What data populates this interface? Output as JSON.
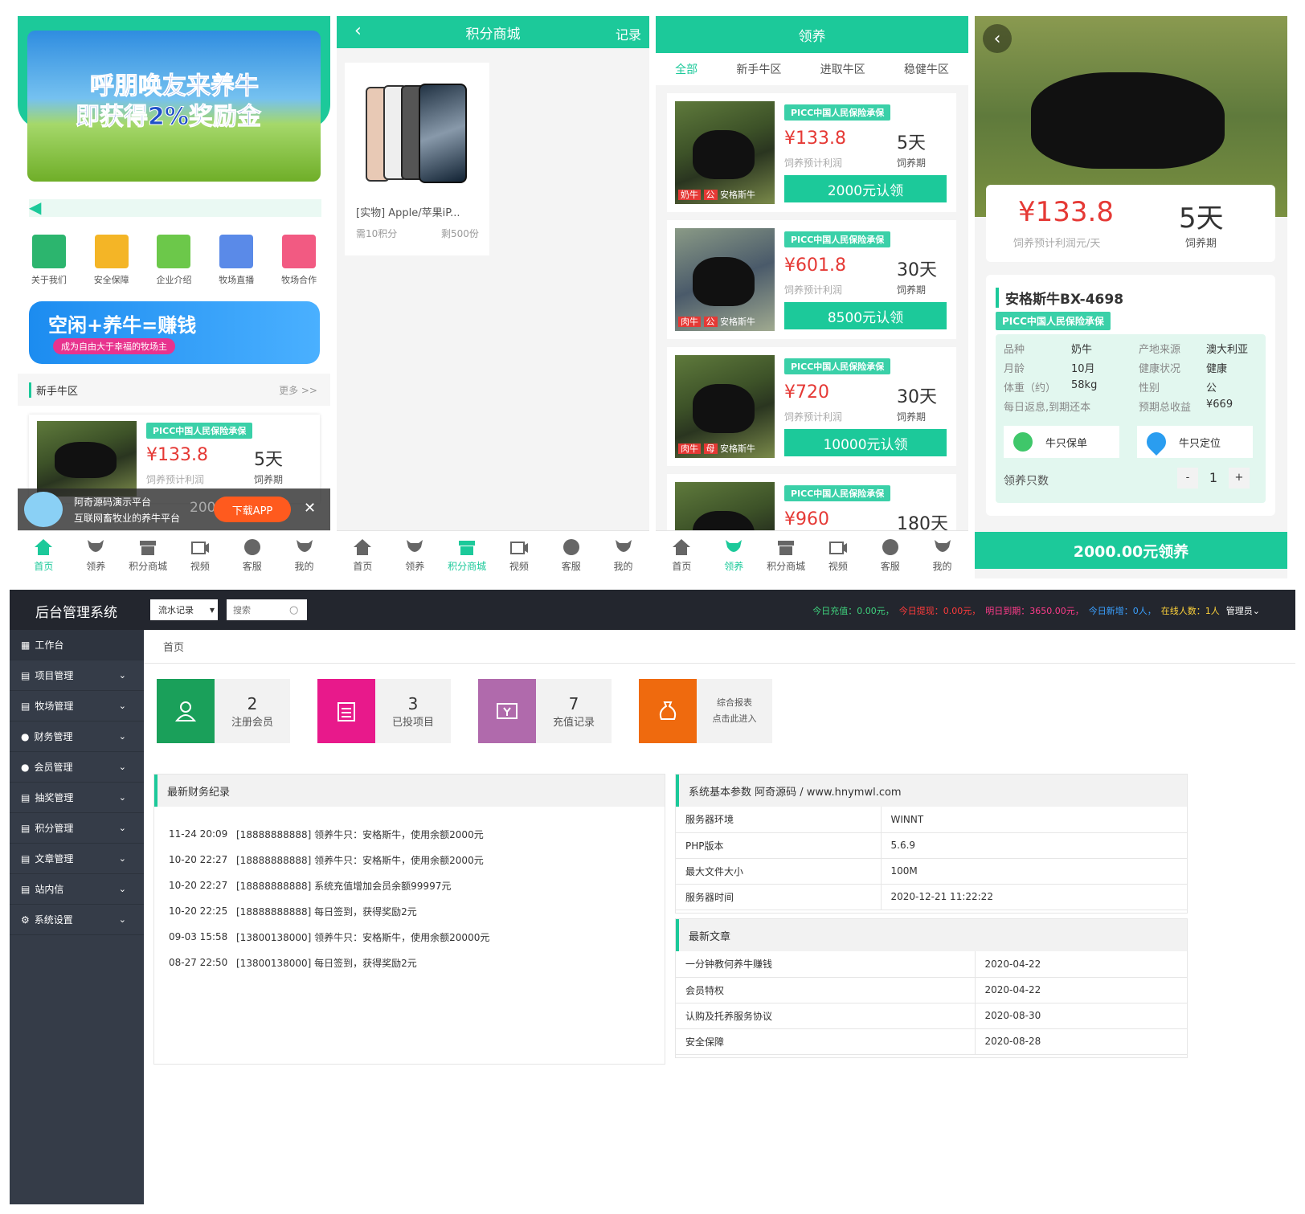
{
  "home": {
    "banner_line1": "呼朋唤友来养牛",
    "banner_line2": "即获得2%奖励金",
    "icons": [
      "关于我们",
      "安全保障",
      "企业介绍",
      "牧场直播",
      "牧场合作"
    ],
    "promo_big": "空闲+养牛=赚钱",
    "promo_small": "成为自由大于幸福的牧场主",
    "section_title": "新手牛区",
    "more": "更多 >>",
    "item": {
      "badge": "PICC中国人民保险承保",
      "price": "¥133.8",
      "days": "5天",
      "profit_label": "饲养预计利润",
      "period_label": "饲养期"
    },
    "app_banner": {
      "line1": "阿奇源码演示平台",
      "line2": "互联网畜牧业的养牛平台",
      "num": "200",
      "button": "下载APP",
      "close": "✕"
    }
  },
  "shop": {
    "title": "积分商城",
    "record": "记录",
    "product_name": "[实物] Apple/苹果iP...",
    "need": "需10积分",
    "remain": "剩500份"
  },
  "adopt": {
    "title": "领养",
    "tabs": [
      "全部",
      "新手牛区",
      "进取牛区",
      "稳健牛区"
    ],
    "items": [
      {
        "badge": "PICC中国人民保险承保",
        "price": "¥133.8",
        "days": "5天",
        "profit_label": "饲养预计利润",
        "period_label": "饲养期",
        "button": "2000元认领",
        "tag1": "奶牛",
        "tag2": "公",
        "breed": "安格斯牛"
      },
      {
        "badge": "PICC中国人民保险承保",
        "price": "¥601.8",
        "days": "30天",
        "profit_label": "饲养预计利润",
        "period_label": "饲养期",
        "button": "8500元认领",
        "tag1": "肉牛",
        "tag2": "公",
        "breed": "安格斯牛"
      },
      {
        "badge": "PICC中国人民保险承保",
        "price": "¥720",
        "days": "30天",
        "profit_label": "饲养预计利润",
        "period_label": "饲养期",
        "button": "10000元认领",
        "tag1": "肉牛",
        "tag2": "母",
        "breed": "安格斯牛"
      },
      {
        "badge": "PICC中国人民保险承保",
        "price": "¥960",
        "days": "180天"
      }
    ]
  },
  "detail": {
    "price": "¥133.8",
    "price_label": "饲养预计利润元/天",
    "days": "5天",
    "days_label": "饲养期",
    "name": "安格斯牛BX-4698",
    "badge": "PICC中国人民保险承保",
    "fields": [
      [
        "品种",
        "奶牛",
        "产地来源",
        "澳大利亚"
      ],
      [
        "月龄",
        "10月",
        "健康状况",
        "健康"
      ],
      [
        "体重（约）",
        "58kg",
        "性别",
        "公"
      ],
      [
        "每日返息,到期还本",
        "",
        "预期总收益",
        "¥669"
      ]
    ],
    "btn_policy": "牛只保单",
    "btn_locate": "牛只定位",
    "qty_label": "领养只数",
    "qty": "1",
    "minus": "-",
    "plus": "+",
    "submit": "2000.00元领养"
  },
  "nav_items": [
    "首页",
    "领养",
    "积分商城",
    "视频",
    "客服",
    "我的"
  ],
  "admin": {
    "title": "后台管理系统",
    "select": "流水记录",
    "search_placeholder": "搜索",
    "stats": [
      {
        "label": "今日充值：",
        "value": "0.00元，",
        "color": "#3fd27d"
      },
      {
        "label": "今日提现：",
        "value": "0.00元，",
        "color": "#ff3b3b"
      },
      {
        "label": "明日到期：",
        "value": "3650.00元，",
        "color": "#ff3b8a"
      },
      {
        "label": "今日新增：",
        "value": "0人，",
        "color": "#3aa0ff"
      },
      {
        "label": "在线人数：",
        "value": "1人",
        "color": "#ffd33a"
      }
    ],
    "user": "管理员",
    "menu": [
      "工作台",
      "项目管理",
      "牧场管理",
      "财务管理",
      "会员管理",
      "抽奖管理",
      "积分管理",
      "文章管理",
      "站内信",
      "系统设置"
    ],
    "breadcrumb": "首页",
    "cards": [
      {
        "num": "2",
        "label": "注册会员",
        "color": "#1aa05a"
      },
      {
        "num": "3",
        "label": "已投项目",
        "color": "#e8198b"
      },
      {
        "num": "7",
        "label": "充值记录",
        "color": "#b06aac"
      },
      {
        "num": "",
        "label": "综合报表",
        "sub": "点击此进入",
        "color": "#ef6a0e"
      }
    ],
    "finance_title": "最新财务纪录",
    "finance": [
      [
        "11-24 20:09",
        "[18888888888] 领养牛只：安格斯牛，使用余额2000元"
      ],
      [
        "10-20 22:27",
        "[18888888888] 领养牛只：安格斯牛，使用余额2000元"
      ],
      [
        "10-20 22:27",
        "[18888888888] 系统充值增加会员余额99997元"
      ],
      [
        "10-20 22:25",
        "[18888888888] 每日签到，获得奖励2元"
      ],
      [
        "09-03 15:58",
        "[13800138000] 领养牛只：安格斯牛，使用余额20000元"
      ],
      [
        "08-27 22:50",
        "[13800138000] 每日签到，获得奖励2元"
      ]
    ],
    "sys_title": "系统基本参数 阿奇源码 / www.hnymwl.com",
    "sys": [
      [
        "服务器环境",
        "WINNT"
      ],
      [
        "PHP版本",
        "5.6.9"
      ],
      [
        "最大文件大小",
        "100M"
      ],
      [
        "服务器时间",
        "2020-12-21 11:22:22"
      ]
    ],
    "article_title": "最新文章",
    "articles": [
      [
        "一分钟教何养牛赚钱",
        "2020-04-22"
      ],
      [
        "会员特权",
        "2020-04-22"
      ],
      [
        "认购及托养服务协议",
        "2020-08-30"
      ],
      [
        "安全保障",
        "2020-08-28"
      ]
    ]
  }
}
